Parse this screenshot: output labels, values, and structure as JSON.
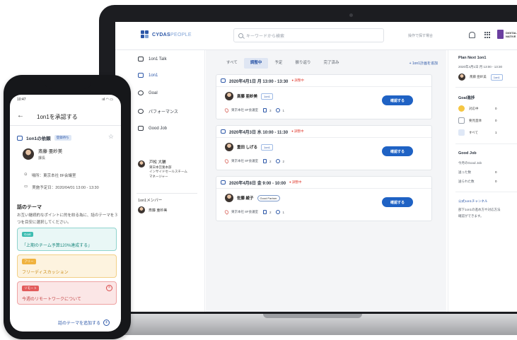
{
  "laptop": {
    "brand": {
      "name": "CYDAS",
      "suffix": "PEOPLE"
    },
    "search_placeholder": "キーワードから検索",
    "top_link": "操作で探す場合",
    "partner_name": "DIGITAL NATIVE",
    "nav": [
      {
        "label": "1on1 Talk"
      },
      {
        "label": "1on1"
      },
      {
        "label": "Goal"
      },
      {
        "label": "パフォーマンス"
      },
      {
        "label": "Good Job"
      }
    ],
    "profile": {
      "name": "戸松 大輔",
      "line1": "東日本営業本部",
      "line2": "インサイドセールスチーム",
      "line3": "マネージャー"
    },
    "members_title": "1on1メンバー",
    "member_name": "斎藤 亜紗美",
    "tabs": [
      "すべて",
      "調整中",
      "予定",
      "振り返り",
      "完了済み"
    ],
    "add_link": "+ 1on1計画を追加",
    "cards": [
      {
        "datetime": "2020年4月1日 月 13:00 - 13:30",
        "status": "● 調整中",
        "name": "斎藤 亜紗美",
        "tag": "1on1",
        "location": "東京本社 8F会議室",
        "docs": "3",
        "comments": "1",
        "button": "確認する"
      },
      {
        "datetime": "2020年4月3日 水 10:00 - 11:30",
        "status": "● 調整中",
        "name": "重田 しげる",
        "tag": "1on1",
        "location": "東京本社 8F会議室",
        "docs": "2",
        "comments": "2",
        "button": "確認する"
      },
      {
        "datetime": "2020年4月8日 金 9:00 - 10:00",
        "status": "● 調整中",
        "name": "佐藤 綾子",
        "tag": "Good Partner",
        "location": "東京本社 8F会議室",
        "docs": "2",
        "comments": "1",
        "button": "確認する"
      }
    ],
    "right": {
      "plan_title": "Plan Next 1on1",
      "plan_date": "2020年4月1日 月 13:00 - 13:30",
      "plan_name": "斎藤 亜紗美",
      "plan_tag": "1on1",
      "goal_title": "Goal進捗",
      "goal_rows": [
        {
          "label": "対応中",
          "count": "0"
        },
        {
          "label": "要見直体",
          "count": "0"
        },
        {
          "label": "すべて",
          "count": "1"
        }
      ],
      "goodjob_title": "Good Job",
      "goodjob_rows": [
        {
          "label": "今月のGood Job",
          "count": ""
        },
        {
          "label": "送った数",
          "count": "0"
        },
        {
          "label": "送られた数",
          "count": "0"
        }
      ],
      "channel_link": "公式1on1チャンネル",
      "channel_text1": "部下1on1の進め方や対応方法",
      "channel_text2": "確認ができます。"
    },
    "colors": {
      "accent": "#1f62c4",
      "status_red": "#e2483d"
    }
  },
  "phone": {
    "time": "10:47",
    "signal": "ııl ◠ ▭",
    "title": "1on1を承認する",
    "request_title": "1on1の依頼",
    "request_badge": "登録待ち",
    "person_name": "斎藤 亜紗美",
    "person_role": "課長",
    "place_label": "場所：東京本社 8F会議室",
    "date_label": "実施予定日：2020/04/01 13:00 - 13:30",
    "section_title": "話のテーマ",
    "desc": "お互い継続的なポイントに的を絞る為に、話のテーマを３つを目安に選択してください。",
    "themes": [
      {
        "tag": "Goal",
        "text": "「上期のチーム予算120%達成する」"
      },
      {
        "tag": "フリー",
        "text": "フリーディスカッション"
      },
      {
        "tag": "リモート",
        "text": "今週のリモートワークについて"
      }
    ],
    "add_theme": "話のテーマを追加する"
  }
}
